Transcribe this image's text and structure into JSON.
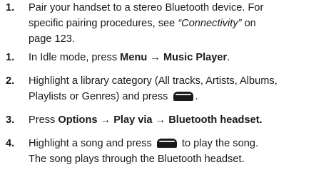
{
  "steps": [
    {
      "number": "1.",
      "lines": [
        "Pair your handset to a stereo Bluetooth device. For",
        "specific pairing procedures, see",
        "page 123."
      ],
      "ref_text": "“Connectivity”",
      "ref_suffix": " on"
    },
    {
      "number": "1.",
      "text": "In Idle mode, press ",
      "menu_path": "Menu → Music Player",
      "end": "."
    },
    {
      "number": "2.",
      "line1": "Highlight a library category (All tracks, Artists, Albums,",
      "line2_prefix": "Playlists or Genres) and press ",
      "line2_suffix": ".",
      "key_icon": "soft-key-icon"
    },
    {
      "number": "3.",
      "text": "Press ",
      "menu_path": "Options → Play via → Bluetooth headset."
    },
    {
      "number": "4.",
      "line1_prefix": "Highlight a song and press ",
      "line1_suffix": " to play the song.",
      "line2": "The song plays through the Bluetooth headset.",
      "key_icon": "soft-key-icon"
    }
  ]
}
